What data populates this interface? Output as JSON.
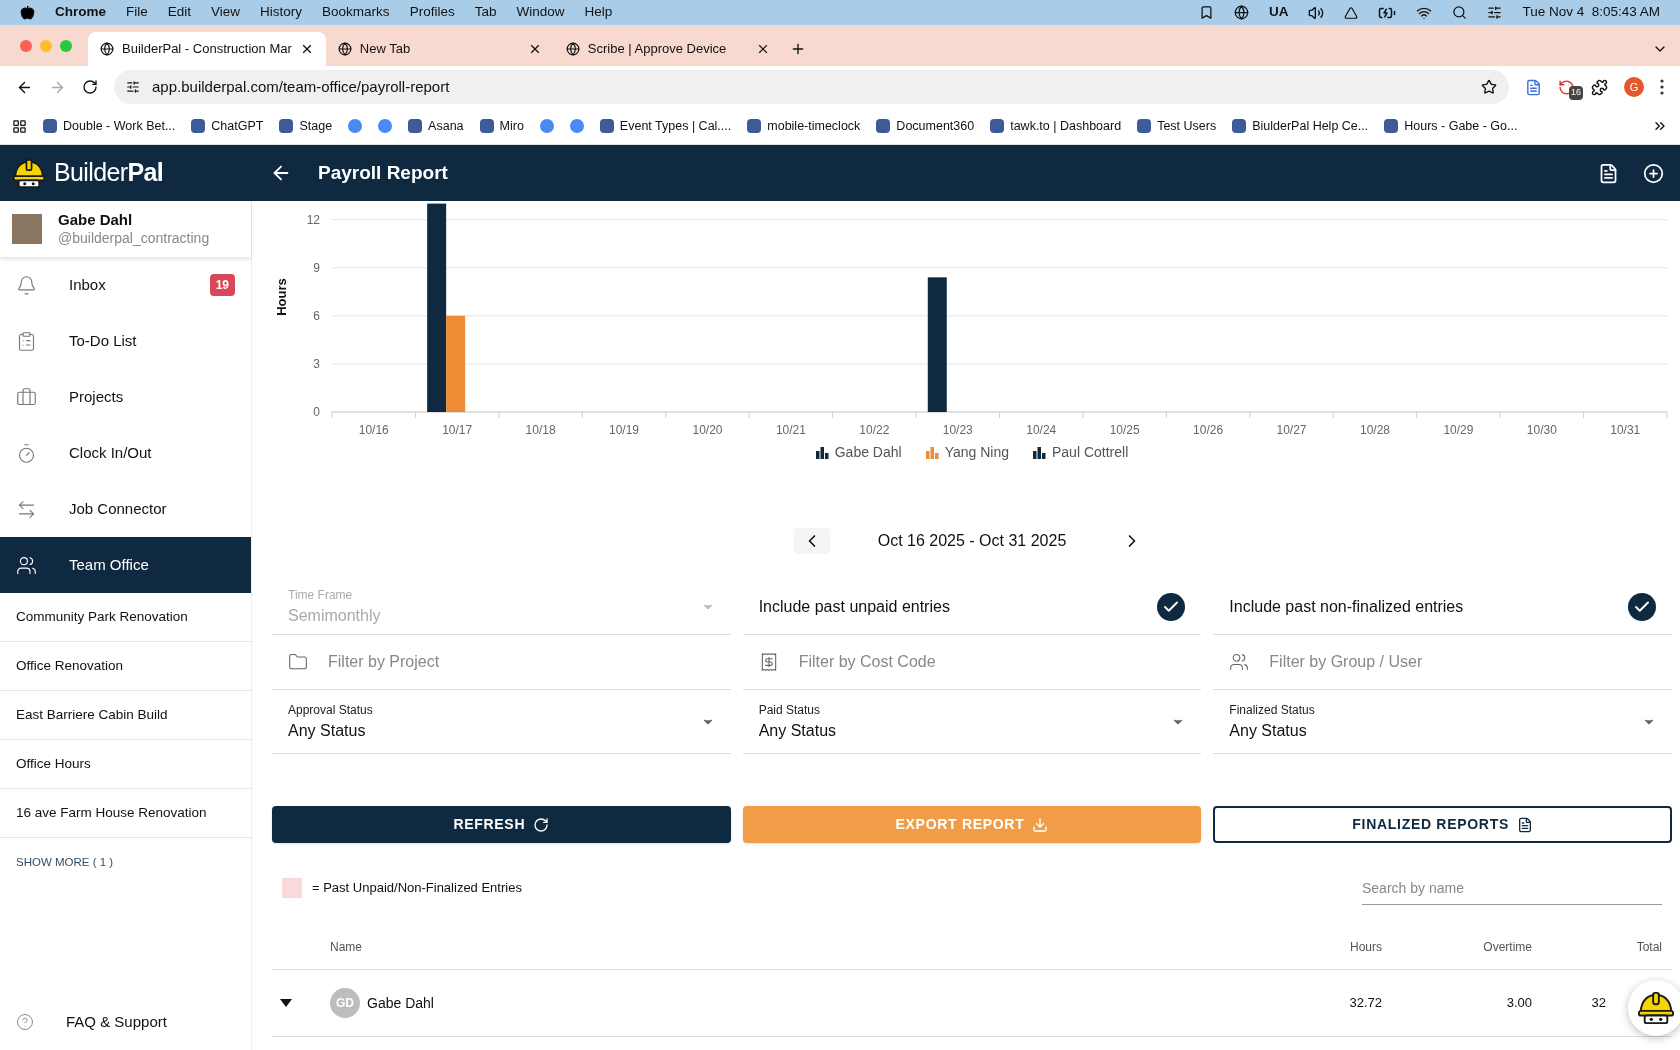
{
  "menu_bar": {
    "app": "Chrome",
    "items": [
      "File",
      "Edit",
      "View",
      "History",
      "Bookmarks",
      "Profiles",
      "Tab",
      "Window",
      "Help"
    ],
    "input_source": "UA",
    "clock": "Tue Nov 4  8:05:43 AM"
  },
  "browser": {
    "tabs": [
      {
        "title": "BuilderPal - Construction Mar",
        "selected": true
      },
      {
        "title": "New Tab",
        "selected": false
      },
      {
        "title": "Scribe | Approve Device",
        "selected": false
      }
    ],
    "url": "app.builderpal.com/team-office/payroll-report",
    "extension_badge": "16",
    "profile_initial": "G",
    "bookmarks": [
      {
        "kind": "link",
        "label": "Double - Work Bet..."
      },
      {
        "kind": "link",
        "label": "ChatGPT"
      },
      {
        "kind": "link",
        "label": "Stage"
      },
      {
        "kind": "icon"
      },
      {
        "kind": "icon"
      },
      {
        "kind": "link",
        "label": "Asana"
      },
      {
        "kind": "link",
        "label": "Miro"
      },
      {
        "kind": "icon"
      },
      {
        "kind": "icon"
      },
      {
        "kind": "link",
        "label": "Event Types | Cal...."
      },
      {
        "kind": "link",
        "label": "mobile-timeclock"
      },
      {
        "kind": "link",
        "label": "Document360"
      },
      {
        "kind": "link",
        "label": "tawk.to | Dashboard"
      },
      {
        "kind": "link",
        "label": "Test Users"
      },
      {
        "kind": "link",
        "label": "BiulderPal Help Ce..."
      },
      {
        "kind": "link",
        "label": "Hours - Gabe - Go..."
      }
    ]
  },
  "app": {
    "brand_light": "Builder",
    "brand_bold": "Pal",
    "title": "Payroll Report"
  },
  "user": {
    "name": "Gabe Dahl",
    "handle": "@builderpal_contracting"
  },
  "nav": [
    {
      "label": "Inbox",
      "badge": "19",
      "selected": false
    },
    {
      "label": "To-Do List",
      "selected": false
    },
    {
      "label": "Projects",
      "selected": false
    },
    {
      "label": "Clock In/Out",
      "selected": false
    },
    {
      "label": "Job Connector",
      "selected": false
    },
    {
      "label": "Team Office",
      "selected": true
    }
  ],
  "projects": [
    "Community Park Renovation",
    "Office Renovation",
    "East Barriere Cabin Build",
    "Office Hours",
    "16 ave Farm House Renovation"
  ],
  "show_more": "SHOW MORE ( 1 )",
  "support": "FAQ & Support",
  "chart_data": {
    "type": "bar",
    "ylabel": "Hours",
    "categories": [
      "10/16",
      "10/17",
      "10/18",
      "10/19",
      "10/20",
      "10/21",
      "10/22",
      "10/23",
      "10/24",
      "10/25",
      "10/26",
      "10/27",
      "10/28",
      "10/29",
      "10/30",
      "10/31"
    ],
    "grid": true,
    "legend": true,
    "series": [
      {
        "name": "Gabe Dahl",
        "color": "#0f2a40",
        "values": [
          0,
          13,
          0,
          0,
          0,
          0,
          0,
          8.4,
          0,
          0,
          0,
          0,
          0,
          0,
          0,
          0
        ]
      },
      {
        "name": "Yang Ning",
        "color": "#ef8a35",
        "values": [
          0,
          6,
          0,
          0,
          0,
          0,
          0,
          0,
          0,
          0,
          0,
          0,
          0,
          0,
          0,
          0
        ]
      },
      {
        "name": "Paul Cottrell",
        "color": "#0f2a40",
        "values": [
          0,
          0,
          0,
          0,
          0,
          0,
          0,
          0,
          0,
          0,
          0,
          0,
          0,
          0,
          0,
          0
        ]
      }
    ],
    "ylim": [
      0,
      13.1
    ],
    "yticks": [
      0,
      3,
      6,
      9,
      12
    ]
  },
  "date_range": "Oct 16 2025 - Oct 31 2025",
  "time_frame": {
    "label": "Time Frame",
    "value": "Semimonthly",
    "disabled": true
  },
  "toggles": [
    {
      "label": "Include past unpaid entries",
      "checked": true
    },
    {
      "label": "Include past non-finalized entries",
      "checked": true
    }
  ],
  "filters": [
    {
      "placeholder": "Filter by Project"
    },
    {
      "placeholder": "Filter by Cost Code"
    },
    {
      "placeholder": "Filter by Group / User"
    }
  ],
  "selects": [
    {
      "label": "Approval Status",
      "value": "Any Status"
    },
    {
      "label": "Paid Status",
      "value": "Any Status"
    },
    {
      "label": "Finalized Status",
      "value": "Any Status"
    }
  ],
  "buttons": [
    {
      "kind": "primary",
      "label": "REFRESH"
    },
    {
      "kind": "accent",
      "label": "EXPORT REPORT"
    },
    {
      "kind": "outline",
      "label": "FINALIZED REPORTS"
    }
  ],
  "legend_note": "= Past Unpaid/Non-Finalized Entries",
  "search": {
    "placeholder": "Search by name"
  },
  "table": {
    "columns": [
      "Name",
      "Hours",
      "Overtime",
      "Total"
    ],
    "rows": [
      {
        "initials": "GD",
        "name": "Gabe Dahl",
        "hours": "32.72",
        "overtime": "3.00",
        "total": "32",
        "expanded": true
      }
    ]
  }
}
